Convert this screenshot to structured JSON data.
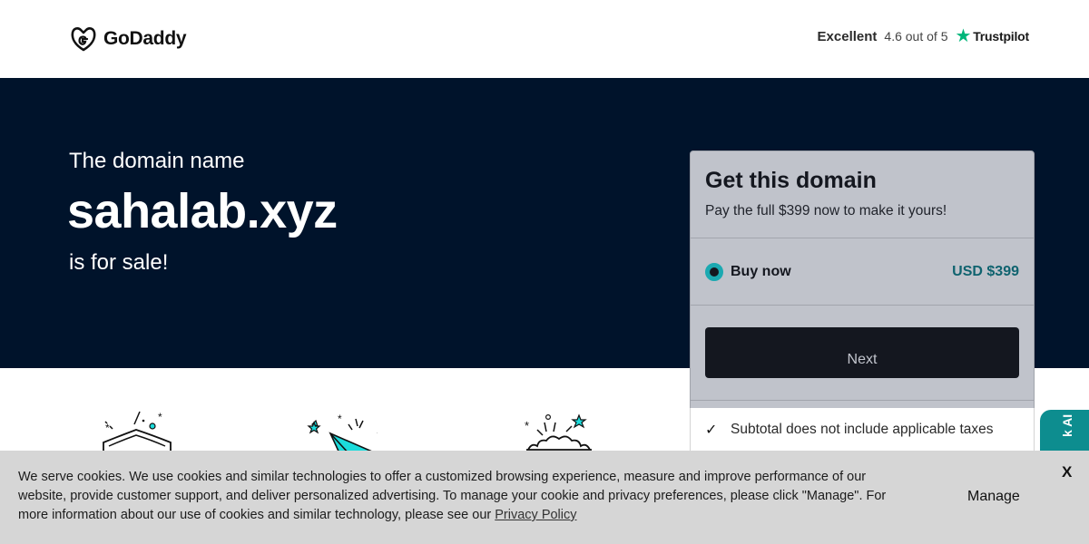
{
  "header": {
    "logo_text": "GoDaddy",
    "trustpilot": {
      "excellent": "Excellent",
      "rating": "4.6 out of 5",
      "brand": "Trustpilot",
      "star_color": "#00b67a"
    }
  },
  "hero": {
    "pre": "The domain name",
    "domain": "sahalab.xyz",
    "post": "is for sale!"
  },
  "card": {
    "title": "Get this domain",
    "subtitle": "Pay the full $399 now to make it yours!",
    "option": {
      "label": "Buy now",
      "price": "USD $399",
      "selected": true
    },
    "next_label": "Next",
    "note": "Subtotal does not include applicable taxes"
  },
  "chat_tab": {
    "label": "k AI"
  },
  "cookie": {
    "text": "We serve cookies. We use cookies and similar technologies to offer a customized browsing experience, measure and improve performance of our website, provide customer support, and deliver personalized advertising. To manage your cookie and privacy preferences, please click \"Manage\". For more information about our use of cookies and similar technology, please see our",
    "link": "Privacy Policy",
    "manage": "Manage",
    "close": "X"
  },
  "colors": {
    "hero_bg": "#00132b",
    "accent_teal": "#1bdbdb",
    "price_teal": "#0b7a80",
    "chat_tab": "#0d8d8f"
  },
  "icons": [
    "godaddy-logo-icon",
    "trustpilot-star-icon",
    "radio-selected-icon",
    "check-icon",
    "shield-icon",
    "paper-plane-icon",
    "celebration-icon"
  ]
}
